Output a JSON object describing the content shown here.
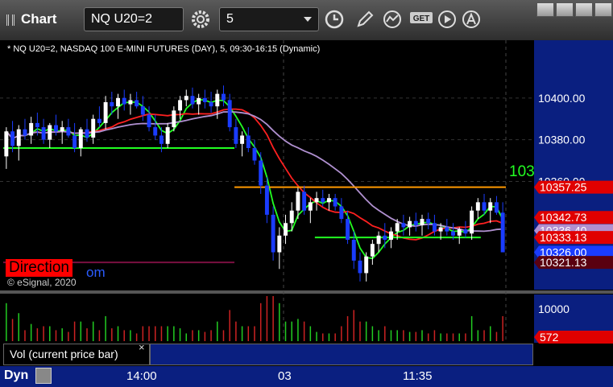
{
  "toolbar": {
    "title": "Chart",
    "symbol": "NQ U20=2",
    "interval": "5"
  },
  "header": {
    "chart_title": "* NQ U20=2, NASDAQ 100 E-MINI FUTURES (DAY), 5, 09:30-16:15 (Dynamic)",
    "esignal": "© eSignal, 2020"
  },
  "labels": {
    "direction": "Direction",
    "direction_suffix": "om",
    "overflow_level": "103"
  },
  "study": {
    "name": "Vol (current price bar)",
    "close": "×"
  },
  "bottom": {
    "dyn": "Dyn"
  },
  "colors": {
    "accent_blue": "#0a1f80",
    "up_bar": "#ffffff",
    "down_bar": "#1a3cff",
    "green_line": "#22ff22",
    "red_line": "#ff2020",
    "purple_line": "#b090d0"
  },
  "chart_data": {
    "type": "candlestick",
    "x_ticks": [
      "14:00",
      "03",
      "11:35"
    ],
    "y_ticks": [
      10400.0,
      10380.0,
      10360.0
    ],
    "ylim": [
      10310,
      10420
    ],
    "price_tags": [
      {
        "label": "10357.25",
        "value": 10357.25,
        "color": "#e00000"
      },
      {
        "label": "10342.73",
        "value": 10342.73,
        "color": "#e00000"
      },
      {
        "label": "10336.40",
        "value": 10336.4,
        "color": "#b090d0"
      },
      {
        "label": "10333.13",
        "value": 10333.13,
        "color": "#e00000"
      },
      {
        "label": "10326.00",
        "value": 10326.0,
        "color": "#1a3cff"
      },
      {
        "label": "10321.13",
        "value": 10321.13,
        "color": "#5a0010"
      }
    ],
    "horizontal_lines": [
      {
        "value": 10376,
        "color": "#22ff22",
        "from": 0.0,
        "to": 0.46
      },
      {
        "value": 10357.25,
        "color": "#ff9900",
        "from": 0.46,
        "to": 1.0
      },
      {
        "value": 10333.13,
        "color": "#22ff22",
        "from": 0.62,
        "to": 0.95
      },
      {
        "value": 10321.13,
        "color": "#7a1040",
        "from": 0.0,
        "to": 0.46
      }
    ],
    "candles": [
      [
        10372,
        10386,
        10366,
        10384
      ],
      [
        10384,
        10389,
        10374,
        10377
      ],
      [
        10377,
        10387,
        10370,
        10385
      ],
      [
        10385,
        10390,
        10380,
        10382
      ],
      [
        10382,
        10391,
        10378,
        10388
      ],
      [
        10388,
        10393,
        10382,
        10386
      ],
      [
        10386,
        10390,
        10378,
        10380
      ],
      [
        10380,
        10388,
        10376,
        10387
      ],
      [
        10387,
        10392,
        10382,
        10384
      ],
      [
        10384,
        10389,
        10378,
        10386
      ],
      [
        10386,
        10390,
        10381,
        10382
      ],
      [
        10382,
        10388,
        10374,
        10376
      ],
      [
        10376,
        10386,
        10372,
        10385
      ],
      [
        10385,
        10390,
        10379,
        10381
      ],
      [
        10381,
        10392,
        10378,
        10390
      ],
      [
        10390,
        10396,
        10386,
        10388
      ],
      [
        10388,
        10401,
        10385,
        10398
      ],
      [
        10398,
        10403,
        10392,
        10396
      ],
      [
        10396,
        10402,
        10390,
        10400
      ],
      [
        10400,
        10404,
        10394,
        10397
      ],
      [
        10397,
        10402,
        10392,
        10399
      ],
      [
        10399,
        10403,
        10395,
        10396
      ],
      [
        10396,
        10401,
        10389,
        10392
      ],
      [
        10392,
        10396,
        10384,
        10386
      ],
      [
        10386,
        10392,
        10380,
        10382
      ],
      [
        10382,
        10386,
        10374,
        10378
      ],
      [
        10378,
        10388,
        10376,
        10386
      ],
      [
        10386,
        10396,
        10384,
        10394
      ],
      [
        10394,
        10401,
        10390,
        10399
      ],
      [
        10399,
        10404,
        10396,
        10401
      ],
      [
        10401,
        10405,
        10395,
        10397
      ],
      [
        10397,
        10402,
        10392,
        10400
      ],
      [
        10400,
        10404,
        10395,
        10398
      ],
      [
        10398,
        10403,
        10393,
        10396
      ],
      [
        10396,
        10404,
        10390,
        10402
      ],
      [
        10402,
        10406,
        10396,
        10399
      ],
      [
        10399,
        10402,
        10384,
        10386
      ],
      [
        10386,
        10390,
        10376,
        10378
      ],
      [
        10378,
        10384,
        10372,
        10382
      ],
      [
        10382,
        10386,
        10374,
        10376
      ],
      [
        10376,
        10380,
        10368,
        10370
      ],
      [
        10370,
        10374,
        10354,
        10358
      ],
      [
        10358,
        10362,
        10340,
        10344
      ],
      [
        10344,
        10348,
        10322,
        10326
      ],
      [
        10326,
        10338,
        10318,
        10334
      ],
      [
        10334,
        10344,
        10330,
        10340
      ],
      [
        10340,
        10350,
        10336,
        10346
      ],
      [
        10346,
        10357,
        10342,
        10355
      ],
      [
        10355,
        10358,
        10344,
        10346
      ],
      [
        10346,
        10352,
        10340,
        10350
      ],
      [
        10350,
        10355,
        10346,
        10352
      ],
      [
        10352,
        10356,
        10348,
        10350
      ],
      [
        10350,
        10354,
        10346,
        10352
      ],
      [
        10352,
        10354,
        10346,
        10348
      ],
      [
        10348,
        10352,
        10340,
        10342
      ],
      [
        10342,
        10346,
        10330,
        10332
      ],
      [
        10332,
        10336,
        10318,
        10322
      ],
      [
        10322,
        10326,
        10312,
        10316
      ],
      [
        10316,
        10326,
        10312,
        10324
      ],
      [
        10324,
        10332,
        10320,
        10330
      ],
      [
        10330,
        10336,
        10326,
        10334
      ],
      [
        10334,
        10340,
        10328,
        10332
      ],
      [
        10332,
        10338,
        10328,
        10336
      ],
      [
        10336,
        10342,
        10332,
        10340
      ],
      [
        10340,
        10344,
        10334,
        10338
      ],
      [
        10338,
        10343,
        10334,
        10341
      ],
      [
        10341,
        10345,
        10336,
        10339
      ],
      [
        10339,
        10344,
        10334,
        10342
      ],
      [
        10342,
        10345,
        10337,
        10340
      ],
      [
        10340,
        10344,
        10334,
        10336
      ],
      [
        10336,
        10340,
        10332,
        10338
      ],
      [
        10338,
        10342,
        10334,
        10336
      ],
      [
        10336,
        10340,
        10332,
        10334
      ],
      [
        10334,
        10338,
        10330,
        10337
      ],
      [
        10337,
        10341,
        10333,
        10335
      ],
      [
        10335,
        10348,
        10332,
        10346
      ],
      [
        10346,
        10352,
        10342,
        10350
      ],
      [
        10350,
        10354,
        10344,
        10346
      ],
      [
        10346,
        10352,
        10340,
        10350
      ],
      [
        10350,
        10353,
        10344,
        10345
      ],
      [
        10345,
        10350,
        10334,
        10326
      ]
    ],
    "volume_ylim": [
      0,
      14000
    ],
    "volume_ticks": [
      10000
    ],
    "volume_tags": [
      {
        "label": "572",
        "value": 572,
        "color": "#e00000"
      }
    ],
    "volume_last": 572
  }
}
